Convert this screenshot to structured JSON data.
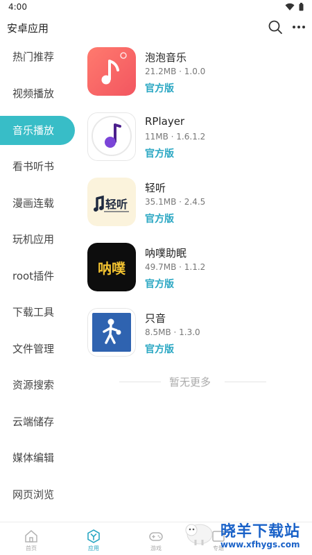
{
  "status_bar": {
    "time": "4:00"
  },
  "app_bar": {
    "title": "安卓应用"
  },
  "categories": [
    {
      "label": "热门推荐"
    },
    {
      "label": "视频播放"
    },
    {
      "label": "音乐播放"
    },
    {
      "label": "看书听书"
    },
    {
      "label": "漫画连载"
    },
    {
      "label": "玩机应用"
    },
    {
      "label": "root插件"
    },
    {
      "label": "下载工具"
    },
    {
      "label": "文件管理"
    },
    {
      "label": "资源搜索"
    },
    {
      "label": "云端储存"
    },
    {
      "label": "媒体编辑"
    },
    {
      "label": "网页浏览"
    }
  ],
  "selected_category": "音乐播放",
  "apps": [
    {
      "name": "泡泡音乐",
      "meta": "21.2MB · 1.0.0",
      "badge": "官方版"
    },
    {
      "name": "RPlayer",
      "meta": "11MB · 1.6.1.2",
      "badge": "官方版"
    },
    {
      "name": "轻听",
      "meta": "35.1MB · 2.4.5",
      "badge": "官方版",
      "icon_text": "轻听"
    },
    {
      "name": "呐噗助眠",
      "meta": "49.7MB · 1.1.2",
      "badge": "官方版",
      "icon_text": "呐噗"
    },
    {
      "name": "只音",
      "meta": "8.5MB · 1.3.0",
      "badge": "官方版"
    }
  ],
  "list_end_text": "暂无更多",
  "bottom_nav": [
    {
      "label": "首页",
      "icon": "home-icon"
    },
    {
      "label": "应用",
      "icon": "apps-icon",
      "active": true
    },
    {
      "label": "游戏",
      "icon": "gamepad-icon"
    },
    {
      "label": "专题",
      "icon": "topic-icon"
    }
  ],
  "watermark": {
    "title": "晓羊下载站",
    "url": "www.xfhygs.com"
  },
  "colors": {
    "accent": "#38bdc7",
    "badge": "#2aa7c3",
    "watermark": "#1a62c8"
  }
}
